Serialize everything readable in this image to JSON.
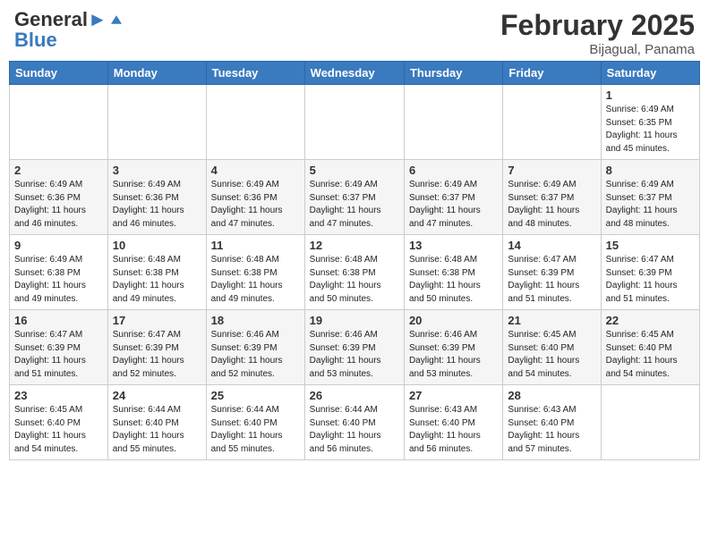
{
  "header": {
    "logo_line1": "General",
    "logo_line2": "Blue",
    "month": "February 2025",
    "location": "Bijagual, Panama"
  },
  "days_of_week": [
    "Sunday",
    "Monday",
    "Tuesday",
    "Wednesday",
    "Thursday",
    "Friday",
    "Saturday"
  ],
  "weeks": [
    [
      {
        "day": "",
        "info": ""
      },
      {
        "day": "",
        "info": ""
      },
      {
        "day": "",
        "info": ""
      },
      {
        "day": "",
        "info": ""
      },
      {
        "day": "",
        "info": ""
      },
      {
        "day": "",
        "info": ""
      },
      {
        "day": "1",
        "info": "Sunrise: 6:49 AM\nSunset: 6:35 PM\nDaylight: 11 hours\nand 45 minutes."
      }
    ],
    [
      {
        "day": "2",
        "info": "Sunrise: 6:49 AM\nSunset: 6:36 PM\nDaylight: 11 hours\nand 46 minutes."
      },
      {
        "day": "3",
        "info": "Sunrise: 6:49 AM\nSunset: 6:36 PM\nDaylight: 11 hours\nand 46 minutes."
      },
      {
        "day": "4",
        "info": "Sunrise: 6:49 AM\nSunset: 6:36 PM\nDaylight: 11 hours\nand 47 minutes."
      },
      {
        "day": "5",
        "info": "Sunrise: 6:49 AM\nSunset: 6:37 PM\nDaylight: 11 hours\nand 47 minutes."
      },
      {
        "day": "6",
        "info": "Sunrise: 6:49 AM\nSunset: 6:37 PM\nDaylight: 11 hours\nand 47 minutes."
      },
      {
        "day": "7",
        "info": "Sunrise: 6:49 AM\nSunset: 6:37 PM\nDaylight: 11 hours\nand 48 minutes."
      },
      {
        "day": "8",
        "info": "Sunrise: 6:49 AM\nSunset: 6:37 PM\nDaylight: 11 hours\nand 48 minutes."
      }
    ],
    [
      {
        "day": "9",
        "info": "Sunrise: 6:49 AM\nSunset: 6:38 PM\nDaylight: 11 hours\nand 49 minutes."
      },
      {
        "day": "10",
        "info": "Sunrise: 6:48 AM\nSunset: 6:38 PM\nDaylight: 11 hours\nand 49 minutes."
      },
      {
        "day": "11",
        "info": "Sunrise: 6:48 AM\nSunset: 6:38 PM\nDaylight: 11 hours\nand 49 minutes."
      },
      {
        "day": "12",
        "info": "Sunrise: 6:48 AM\nSunset: 6:38 PM\nDaylight: 11 hours\nand 50 minutes."
      },
      {
        "day": "13",
        "info": "Sunrise: 6:48 AM\nSunset: 6:38 PM\nDaylight: 11 hours\nand 50 minutes."
      },
      {
        "day": "14",
        "info": "Sunrise: 6:47 AM\nSunset: 6:39 PM\nDaylight: 11 hours\nand 51 minutes."
      },
      {
        "day": "15",
        "info": "Sunrise: 6:47 AM\nSunset: 6:39 PM\nDaylight: 11 hours\nand 51 minutes."
      }
    ],
    [
      {
        "day": "16",
        "info": "Sunrise: 6:47 AM\nSunset: 6:39 PM\nDaylight: 11 hours\nand 51 minutes."
      },
      {
        "day": "17",
        "info": "Sunrise: 6:47 AM\nSunset: 6:39 PM\nDaylight: 11 hours\nand 52 minutes."
      },
      {
        "day": "18",
        "info": "Sunrise: 6:46 AM\nSunset: 6:39 PM\nDaylight: 11 hours\nand 52 minutes."
      },
      {
        "day": "19",
        "info": "Sunrise: 6:46 AM\nSunset: 6:39 PM\nDaylight: 11 hours\nand 53 minutes."
      },
      {
        "day": "20",
        "info": "Sunrise: 6:46 AM\nSunset: 6:39 PM\nDaylight: 11 hours\nand 53 minutes."
      },
      {
        "day": "21",
        "info": "Sunrise: 6:45 AM\nSunset: 6:40 PM\nDaylight: 11 hours\nand 54 minutes."
      },
      {
        "day": "22",
        "info": "Sunrise: 6:45 AM\nSunset: 6:40 PM\nDaylight: 11 hours\nand 54 minutes."
      }
    ],
    [
      {
        "day": "23",
        "info": "Sunrise: 6:45 AM\nSunset: 6:40 PM\nDaylight: 11 hours\nand 54 minutes."
      },
      {
        "day": "24",
        "info": "Sunrise: 6:44 AM\nSunset: 6:40 PM\nDaylight: 11 hours\nand 55 minutes."
      },
      {
        "day": "25",
        "info": "Sunrise: 6:44 AM\nSunset: 6:40 PM\nDaylight: 11 hours\nand 55 minutes."
      },
      {
        "day": "26",
        "info": "Sunrise: 6:44 AM\nSunset: 6:40 PM\nDaylight: 11 hours\nand 56 minutes."
      },
      {
        "day": "27",
        "info": "Sunrise: 6:43 AM\nSunset: 6:40 PM\nDaylight: 11 hours\nand 56 minutes."
      },
      {
        "day": "28",
        "info": "Sunrise: 6:43 AM\nSunset: 6:40 PM\nDaylight: 11 hours\nand 57 minutes."
      },
      {
        "day": "",
        "info": ""
      }
    ]
  ],
  "alt_rows": [
    1,
    3
  ]
}
